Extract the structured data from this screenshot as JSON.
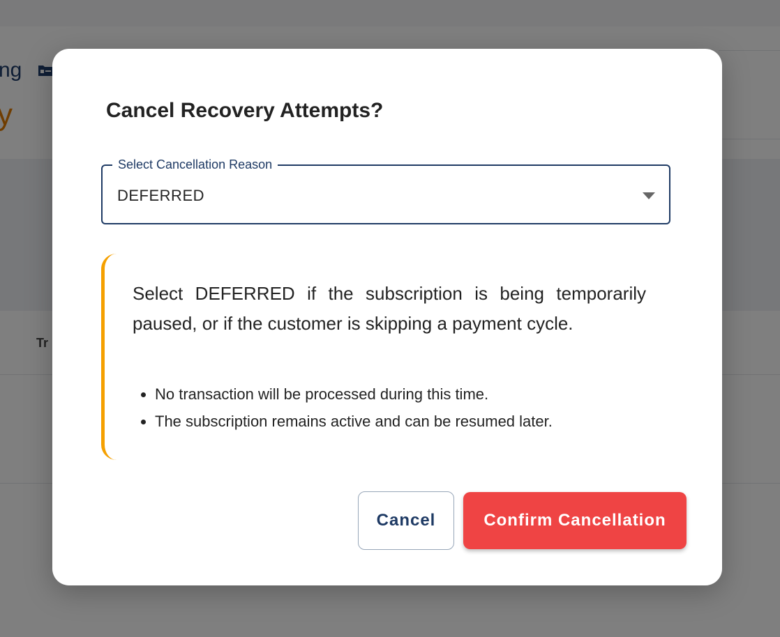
{
  "background": {
    "fragment_1": "ng",
    "fragment_2": "y",
    "fragment_3": "Tr",
    "folder_icon": "folder-icon"
  },
  "dialog": {
    "title": "Cancel Recovery Attempts?",
    "select": {
      "label": "Select Cancellation Reason",
      "value": "DEFERRED",
      "icon": "chevron-down-icon"
    },
    "callout": {
      "accent_color": "#f5a000",
      "description": "Select DEFERRED if the subscription is being temporarily paused, or if the customer is skipping a payment cycle.",
      "bullets": [
        "No transaction will be processed during this time.",
        "The subscription remains active and can be resumed later."
      ]
    },
    "buttons": {
      "cancel_label": "Cancel",
      "confirm_label": "Confirm Cancellation",
      "confirm_color": "#ef4444",
      "primary_text_color": "#1e3a64"
    }
  }
}
